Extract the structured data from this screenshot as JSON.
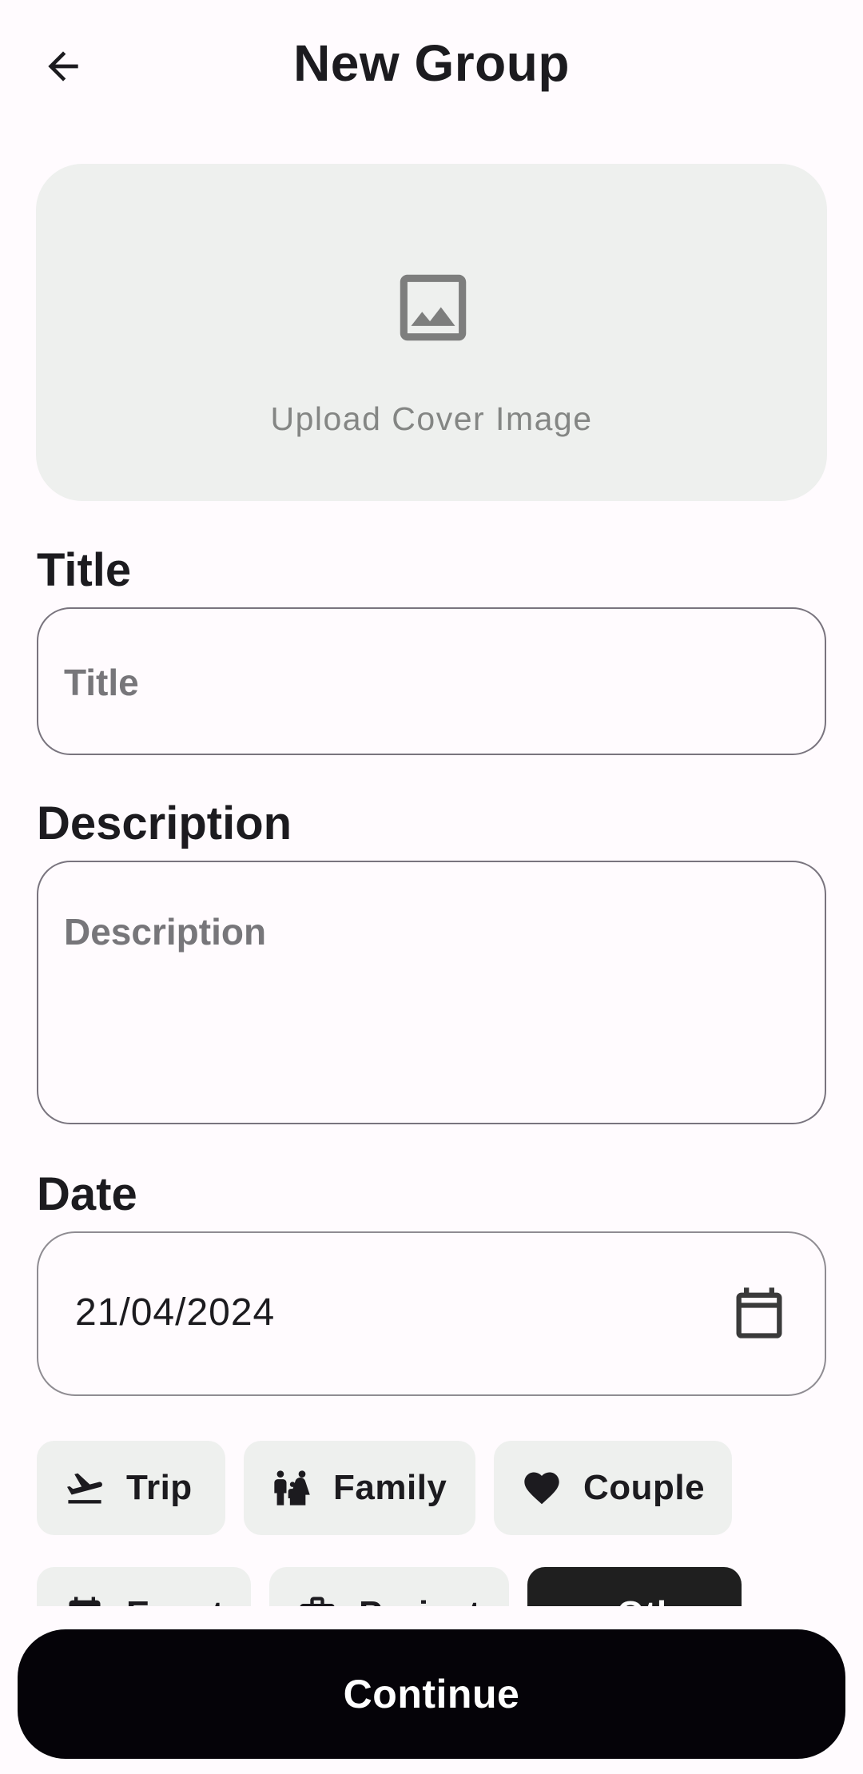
{
  "header": {
    "title": "New Group",
    "back_icon": "arrow-back-icon"
  },
  "cover": {
    "label": "Upload Cover Image",
    "icon": "image-icon"
  },
  "title_field": {
    "label": "Title",
    "placeholder": "Title",
    "value": ""
  },
  "description_field": {
    "label": "Description",
    "placeholder": "Description",
    "value": ""
  },
  "date_field": {
    "label": "Date",
    "value": "21/04/2024",
    "icon": "calendar-icon"
  },
  "categories": [
    {
      "label": "Trip",
      "icon": "flight-takeoff-icon",
      "selected": false
    },
    {
      "label": "Family",
      "icon": "family-icon",
      "selected": false
    },
    {
      "label": "Couple",
      "icon": "heart-icon",
      "selected": false
    },
    {
      "label": "Event",
      "icon": "calendar-icon",
      "selected": false
    },
    {
      "label": "Project",
      "icon": "briefcase-icon",
      "selected": false
    },
    {
      "label": "Other",
      "icon": "more-icon",
      "selected": true
    }
  ],
  "footer": {
    "continue_label": "Continue"
  },
  "colors": {
    "background": "#fffbfe",
    "cover_bg": "#eef0ee",
    "chip_bg": "#eef0ee",
    "chip_selected_bg": "#1f1f1f",
    "button_bg": "#050308",
    "outline": "#79747e"
  }
}
